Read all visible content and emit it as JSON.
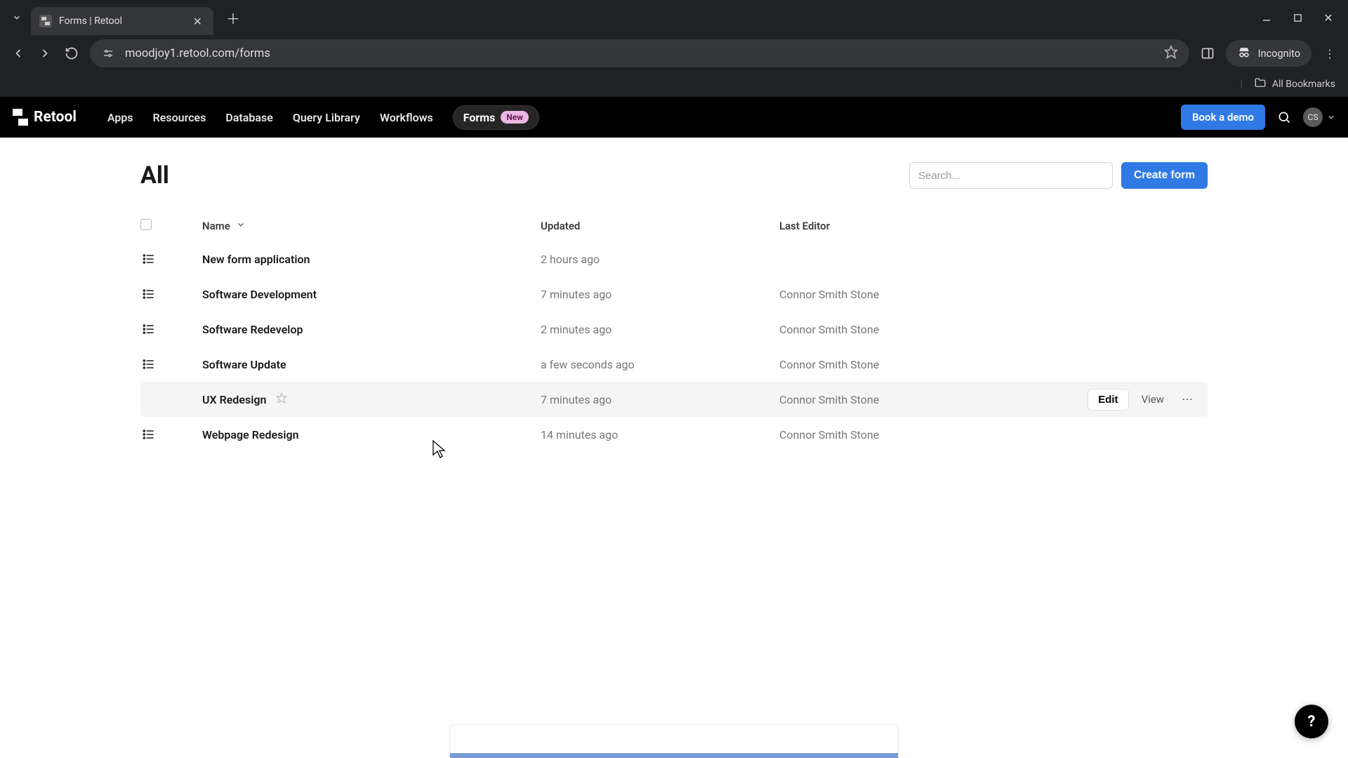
{
  "browser": {
    "tab_title": "Forms | Retool",
    "url": "moodjoy1.retool.com/forms",
    "incognito_label": "Incognito",
    "bookmarks_label": "All Bookmarks"
  },
  "header": {
    "brand": "Retool",
    "nav": {
      "apps": "Apps",
      "resources": "Resources",
      "database": "Database",
      "query_library": "Query Library",
      "workflows": "Workflows",
      "forms": "Forms",
      "forms_badge": "New"
    },
    "book_demo": "Book a demo",
    "avatar_initials": "CS"
  },
  "page": {
    "title": "All",
    "search_placeholder": "Search...",
    "create_button": "Create form"
  },
  "table": {
    "columns": {
      "name": "Name",
      "updated": "Updated",
      "last_editor": "Last Editor"
    },
    "row_actions": {
      "edit": "Edit",
      "view": "View"
    },
    "rows": [
      {
        "name": "New form application",
        "updated": "2 hours ago",
        "last_editor": ""
      },
      {
        "name": "Software Development",
        "updated": "7 minutes ago",
        "last_editor": "Connor Smith Stone"
      },
      {
        "name": "Software Redevelop",
        "updated": "2 minutes ago",
        "last_editor": "Connor Smith Stone"
      },
      {
        "name": "Software Update",
        "updated": "a few seconds ago",
        "last_editor": "Connor Smith Stone"
      },
      {
        "name": "UX Redesign",
        "updated": "7 minutes ago",
        "last_editor": "Connor Smith Stone"
      },
      {
        "name": "Webpage Redesign",
        "updated": "14 minutes ago",
        "last_editor": "Connor Smith Stone"
      }
    ],
    "hovered_index": 4
  },
  "help_fab": "?"
}
